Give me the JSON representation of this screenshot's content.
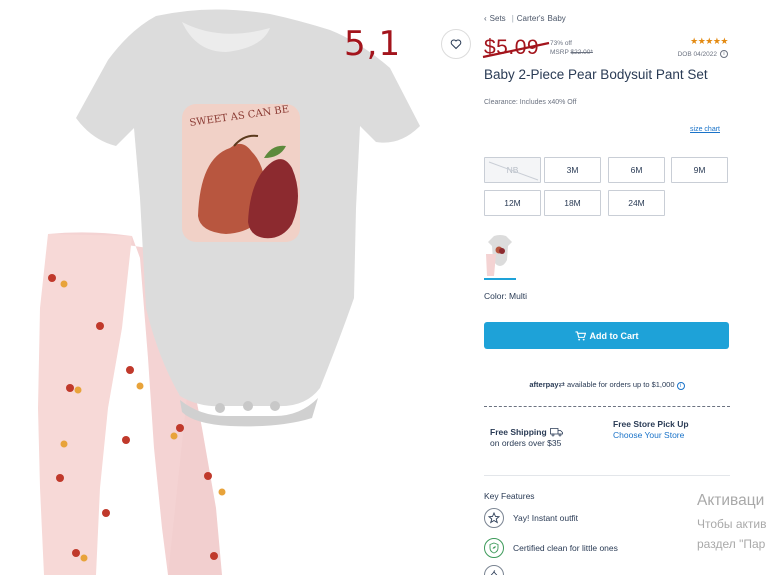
{
  "handwritten_note": "5,1",
  "breadcrumb": [
    "Sets",
    "Carter's",
    "Baby"
  ],
  "price": {
    "current": "$5.09",
    "discount": "73% off",
    "msrp_label": "MSRP",
    "msrp_value": "$22.00*"
  },
  "rating": {
    "stars": 5,
    "glyphs": "★★★★★",
    "color": "#e38a12"
  },
  "dob": {
    "label": "DOB 04/2022",
    "icon": "info-icon"
  },
  "product": {
    "title": "Baby 2-Piece Pear Bodysuit Pant Set",
    "clearance": "Clearance: Includes x40% Off",
    "graphic_text": "SWEET AS CAN BE"
  },
  "size_chart_link": "size chart",
  "sizes": [
    {
      "label": "NB",
      "available": false
    },
    {
      "label": "3M",
      "available": true
    },
    {
      "label": "6M",
      "available": true
    },
    {
      "label": "9M",
      "available": true
    },
    {
      "label": "12M",
      "available": true
    },
    {
      "label": "18M",
      "available": true
    },
    {
      "label": "24M",
      "available": true
    }
  ],
  "color": {
    "label": "Color: Multi"
  },
  "add_to_cart": {
    "label": "Add to Cart",
    "icon": "cart-icon",
    "color": "#1ea2d8"
  },
  "afterpay": {
    "brand": "afterpay",
    "text": "available for orders up to $1,000"
  },
  "shipping": {
    "title": "Free Shipping",
    "sub": "on orders over $35",
    "icon": "truck-icon"
  },
  "pickup": {
    "title": "Free Store Pick Up",
    "link": "Choose Your Store"
  },
  "key_features": {
    "title": "Key Features",
    "items": [
      {
        "label": "Yay! Instant outfit",
        "icon": "star-badge-icon"
      },
      {
        "label": "Certified clean for little ones",
        "icon": "shield-leaf-icon"
      },
      {
        "label": "",
        "icon": "hanger-icon"
      }
    ]
  },
  "watermark": {
    "title": "Активаци",
    "line1": "Чтобы актив",
    "line2": "раздел \"Пар"
  },
  "colors": {
    "accent": "#1ea2d8",
    "price": "#a3141c",
    "text": "#2a3b55",
    "link": "#1a73c9"
  }
}
